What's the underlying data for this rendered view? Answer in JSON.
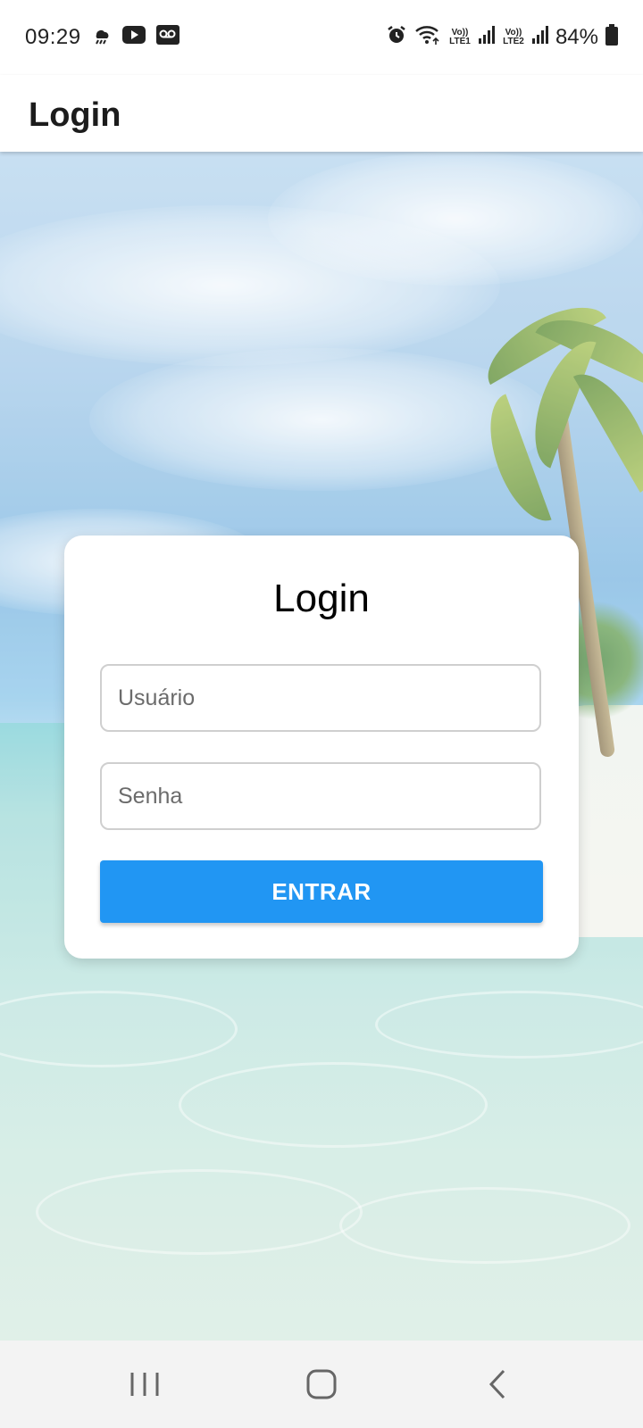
{
  "status_bar": {
    "time": "09:29",
    "left_icons": [
      "weather-storm-icon",
      "youtube-icon",
      "voicemail-icon"
    ],
    "right_icons": [
      "alarm-icon",
      "wifi-icon",
      "volte1-icon",
      "signal1-icon",
      "volte2-icon",
      "signal2-icon",
      "battery-icon"
    ],
    "volte1_label": "Vo)) LTE1",
    "volte2_label": "Vo)) LTE2",
    "battery": "84%"
  },
  "app_bar": {
    "title": "Login"
  },
  "login_card": {
    "title": "Login",
    "username_placeholder": "Usuário",
    "username_value": "",
    "password_placeholder": "Senha",
    "password_value": "",
    "submit_label": "ENTRAR",
    "submit_color": "#2196f3"
  },
  "nav_bar": {
    "buttons": [
      "recents-icon",
      "home-icon",
      "back-icon"
    ]
  },
  "colors": {
    "accent": "#2196f3",
    "card_background": "#ffffff",
    "nav_background": "#f3f3f3"
  }
}
